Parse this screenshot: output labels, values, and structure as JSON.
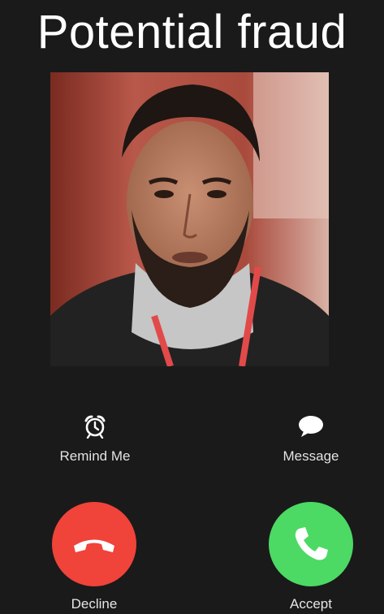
{
  "title": "Potential fraud",
  "caller_photo": {
    "icon": "caller-photo"
  },
  "actions": {
    "remind": {
      "label": "Remind Me",
      "icon": "alarm-clock-icon"
    },
    "message": {
      "label": "Message",
      "icon": "chat-bubble-icon"
    }
  },
  "call": {
    "decline": {
      "label": "Decline",
      "icon": "phone-hangup-icon",
      "color": "#f0433a"
    },
    "accept": {
      "label": "Accept",
      "icon": "phone-icon",
      "color": "#4cd964"
    }
  },
  "colors": {
    "background": "#1a1a1a",
    "text": "#ffffff"
  }
}
